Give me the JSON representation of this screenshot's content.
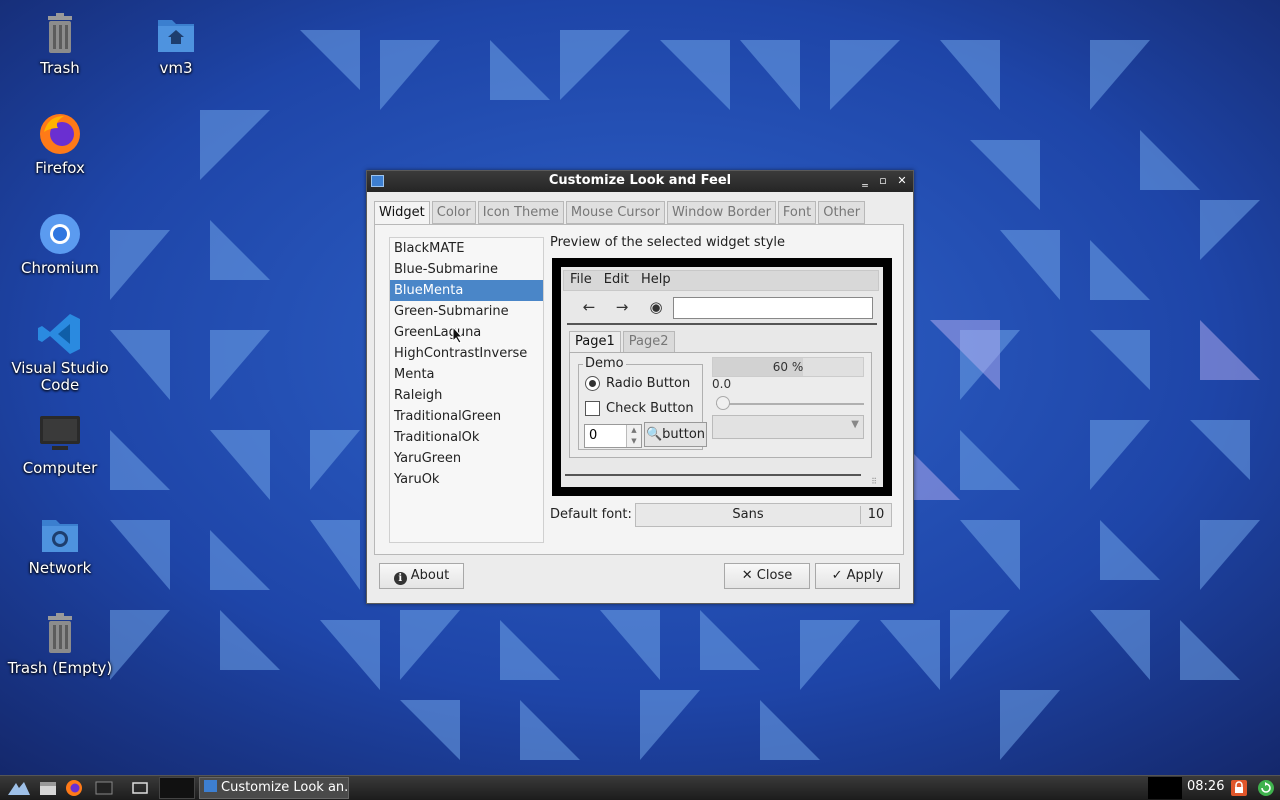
{
  "desktop": {
    "icons": [
      {
        "label": "Trash",
        "icon": "trash-icon"
      },
      {
        "label": "vm3",
        "icon": "home-folder-icon"
      },
      {
        "label": "Firefox",
        "icon": "firefox-icon"
      },
      {
        "label": "Chromium",
        "icon": "chromium-icon"
      },
      {
        "label": "Visual Studio Code",
        "icon": "vscode-icon"
      },
      {
        "label": "Computer",
        "icon": "computer-icon"
      },
      {
        "label": "Network",
        "icon": "network-folder-icon"
      },
      {
        "label": "Trash (Empty)",
        "icon": "trash-icon"
      }
    ]
  },
  "window": {
    "title": "Customize Look and Feel",
    "controls": {
      "minimize": "‗",
      "maximize": "▫",
      "close": "✕"
    },
    "tabs": [
      "Widget",
      "Color",
      "Icon Theme",
      "Mouse Cursor",
      "Window Border",
      "Font",
      "Other"
    ],
    "active_tab": "Widget",
    "themes": [
      "BlackMATE",
      "Blue-Submarine",
      "BlueMenta",
      "Green-Submarine",
      "GreenLaguna",
      "HighContrastInverse",
      "Menta",
      "Raleigh",
      "TraditionalGreen",
      "TraditionalOk",
      "YaruGreen",
      "YaruOk"
    ],
    "selected_theme": "BlueMenta",
    "preview_label": "Preview of the selected widget style",
    "preview": {
      "menu": [
        "File",
        "Edit",
        "Help"
      ],
      "tabs": [
        "Page1",
        "Page2"
      ],
      "demo_label": "Demo",
      "radio_label": "Radio Button",
      "check_label": "Check Button",
      "spin_value": "0",
      "button_label": "button",
      "progress_label": "60 %",
      "progress_value": 0.6,
      "scale_value": "0.0"
    },
    "default_font_label": "Default font:",
    "font_name": "Sans",
    "font_size": "10",
    "buttons": {
      "about": "About",
      "close": "Close",
      "apply": "Apply"
    }
  },
  "taskbar": {
    "task_label": "Customize Look an...",
    "clock": "08:26"
  },
  "colors": {
    "selection": "#4a86c8",
    "titlebar": "#2b2b2b",
    "wallpaper": "#1d3f9a"
  }
}
